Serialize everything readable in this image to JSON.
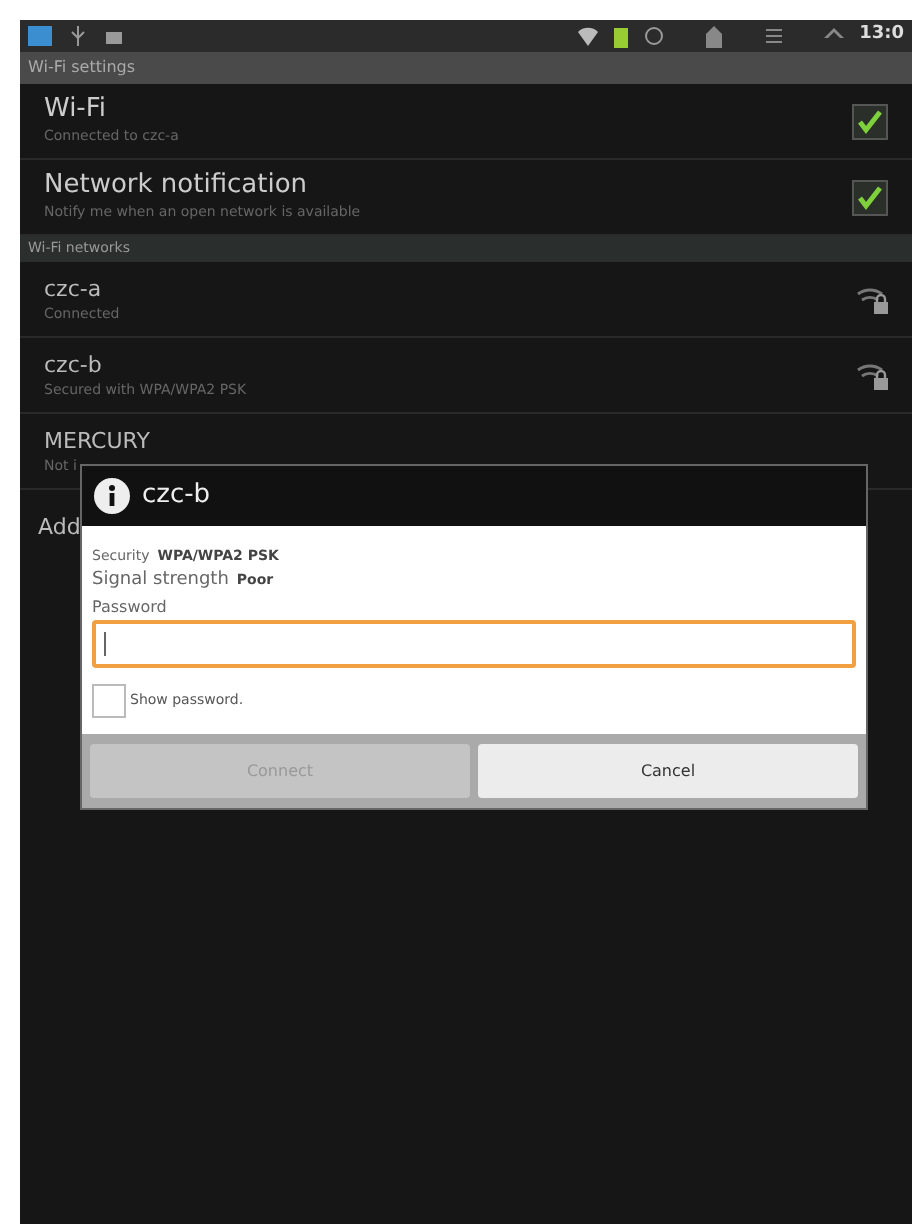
{
  "status_bar": {
    "time": "13:0"
  },
  "header": {
    "title": "Wi-Fi settings"
  },
  "settings": [
    {
      "title": "Wi-Fi",
      "subtitle": "Connected to czc-a",
      "checked": true
    },
    {
      "title": "Network notification",
      "subtitle": "Notify me when an open network is available",
      "checked": true
    }
  ],
  "networks_header": "Wi-Fi networks",
  "networks": [
    {
      "kind": "network",
      "name": "czc-a",
      "subtitle": "Connected"
    },
    {
      "kind": "network",
      "name": "czc-b",
      "subtitle": "Secured with WPA/WPA2 PSK"
    },
    {
      "kind": "partial",
      "name": "MERCURY",
      "subtitle": "Not i"
    },
    {
      "kind": "add",
      "name": "Add"
    }
  ],
  "dialog": {
    "title": "czc-b",
    "security_label": "Security",
    "security_value": "WPA/WPA2 PSK",
    "signal_label": "Signal strength",
    "signal_value": "Poor",
    "password_label": "Password",
    "show_password": {
      "label": "Show password.",
      "checked": false
    },
    "buttons": [
      {
        "label": "Connect",
        "disabled": true
      },
      {
        "label": "Cancel",
        "disabled": false
      }
    ]
  }
}
